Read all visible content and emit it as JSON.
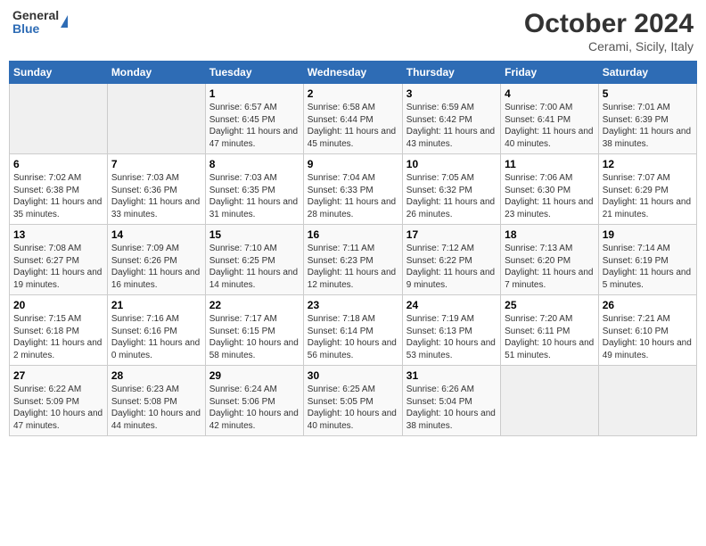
{
  "header": {
    "logo_general": "General",
    "logo_blue": "Blue",
    "month_title": "October 2024",
    "subtitle": "Cerami, Sicily, Italy"
  },
  "weekdays": [
    "Sunday",
    "Monday",
    "Tuesday",
    "Wednesday",
    "Thursday",
    "Friday",
    "Saturday"
  ],
  "weeks": [
    [
      {
        "day": "",
        "info": ""
      },
      {
        "day": "",
        "info": ""
      },
      {
        "day": "1",
        "info": "Sunrise: 6:57 AM\nSunset: 6:45 PM\nDaylight: 11 hours and 47 minutes."
      },
      {
        "day": "2",
        "info": "Sunrise: 6:58 AM\nSunset: 6:44 PM\nDaylight: 11 hours and 45 minutes."
      },
      {
        "day": "3",
        "info": "Sunrise: 6:59 AM\nSunset: 6:42 PM\nDaylight: 11 hours and 43 minutes."
      },
      {
        "day": "4",
        "info": "Sunrise: 7:00 AM\nSunset: 6:41 PM\nDaylight: 11 hours and 40 minutes."
      },
      {
        "day": "5",
        "info": "Sunrise: 7:01 AM\nSunset: 6:39 PM\nDaylight: 11 hours and 38 minutes."
      }
    ],
    [
      {
        "day": "6",
        "info": "Sunrise: 7:02 AM\nSunset: 6:38 PM\nDaylight: 11 hours and 35 minutes."
      },
      {
        "day": "7",
        "info": "Sunrise: 7:03 AM\nSunset: 6:36 PM\nDaylight: 11 hours and 33 minutes."
      },
      {
        "day": "8",
        "info": "Sunrise: 7:03 AM\nSunset: 6:35 PM\nDaylight: 11 hours and 31 minutes."
      },
      {
        "day": "9",
        "info": "Sunrise: 7:04 AM\nSunset: 6:33 PM\nDaylight: 11 hours and 28 minutes."
      },
      {
        "day": "10",
        "info": "Sunrise: 7:05 AM\nSunset: 6:32 PM\nDaylight: 11 hours and 26 minutes."
      },
      {
        "day": "11",
        "info": "Sunrise: 7:06 AM\nSunset: 6:30 PM\nDaylight: 11 hours and 23 minutes."
      },
      {
        "day": "12",
        "info": "Sunrise: 7:07 AM\nSunset: 6:29 PM\nDaylight: 11 hours and 21 minutes."
      }
    ],
    [
      {
        "day": "13",
        "info": "Sunrise: 7:08 AM\nSunset: 6:27 PM\nDaylight: 11 hours and 19 minutes."
      },
      {
        "day": "14",
        "info": "Sunrise: 7:09 AM\nSunset: 6:26 PM\nDaylight: 11 hours and 16 minutes."
      },
      {
        "day": "15",
        "info": "Sunrise: 7:10 AM\nSunset: 6:25 PM\nDaylight: 11 hours and 14 minutes."
      },
      {
        "day": "16",
        "info": "Sunrise: 7:11 AM\nSunset: 6:23 PM\nDaylight: 11 hours and 12 minutes."
      },
      {
        "day": "17",
        "info": "Sunrise: 7:12 AM\nSunset: 6:22 PM\nDaylight: 11 hours and 9 minutes."
      },
      {
        "day": "18",
        "info": "Sunrise: 7:13 AM\nSunset: 6:20 PM\nDaylight: 11 hours and 7 minutes."
      },
      {
        "day": "19",
        "info": "Sunrise: 7:14 AM\nSunset: 6:19 PM\nDaylight: 11 hours and 5 minutes."
      }
    ],
    [
      {
        "day": "20",
        "info": "Sunrise: 7:15 AM\nSunset: 6:18 PM\nDaylight: 11 hours and 2 minutes."
      },
      {
        "day": "21",
        "info": "Sunrise: 7:16 AM\nSunset: 6:16 PM\nDaylight: 11 hours and 0 minutes."
      },
      {
        "day": "22",
        "info": "Sunrise: 7:17 AM\nSunset: 6:15 PM\nDaylight: 10 hours and 58 minutes."
      },
      {
        "day": "23",
        "info": "Sunrise: 7:18 AM\nSunset: 6:14 PM\nDaylight: 10 hours and 56 minutes."
      },
      {
        "day": "24",
        "info": "Sunrise: 7:19 AM\nSunset: 6:13 PM\nDaylight: 10 hours and 53 minutes."
      },
      {
        "day": "25",
        "info": "Sunrise: 7:20 AM\nSunset: 6:11 PM\nDaylight: 10 hours and 51 minutes."
      },
      {
        "day": "26",
        "info": "Sunrise: 7:21 AM\nSunset: 6:10 PM\nDaylight: 10 hours and 49 minutes."
      }
    ],
    [
      {
        "day": "27",
        "info": "Sunrise: 6:22 AM\nSunset: 5:09 PM\nDaylight: 10 hours and 47 minutes."
      },
      {
        "day": "28",
        "info": "Sunrise: 6:23 AM\nSunset: 5:08 PM\nDaylight: 10 hours and 44 minutes."
      },
      {
        "day": "29",
        "info": "Sunrise: 6:24 AM\nSunset: 5:06 PM\nDaylight: 10 hours and 42 minutes."
      },
      {
        "day": "30",
        "info": "Sunrise: 6:25 AM\nSunset: 5:05 PM\nDaylight: 10 hours and 40 minutes."
      },
      {
        "day": "31",
        "info": "Sunrise: 6:26 AM\nSunset: 5:04 PM\nDaylight: 10 hours and 38 minutes."
      },
      {
        "day": "",
        "info": ""
      },
      {
        "day": "",
        "info": ""
      }
    ]
  ]
}
